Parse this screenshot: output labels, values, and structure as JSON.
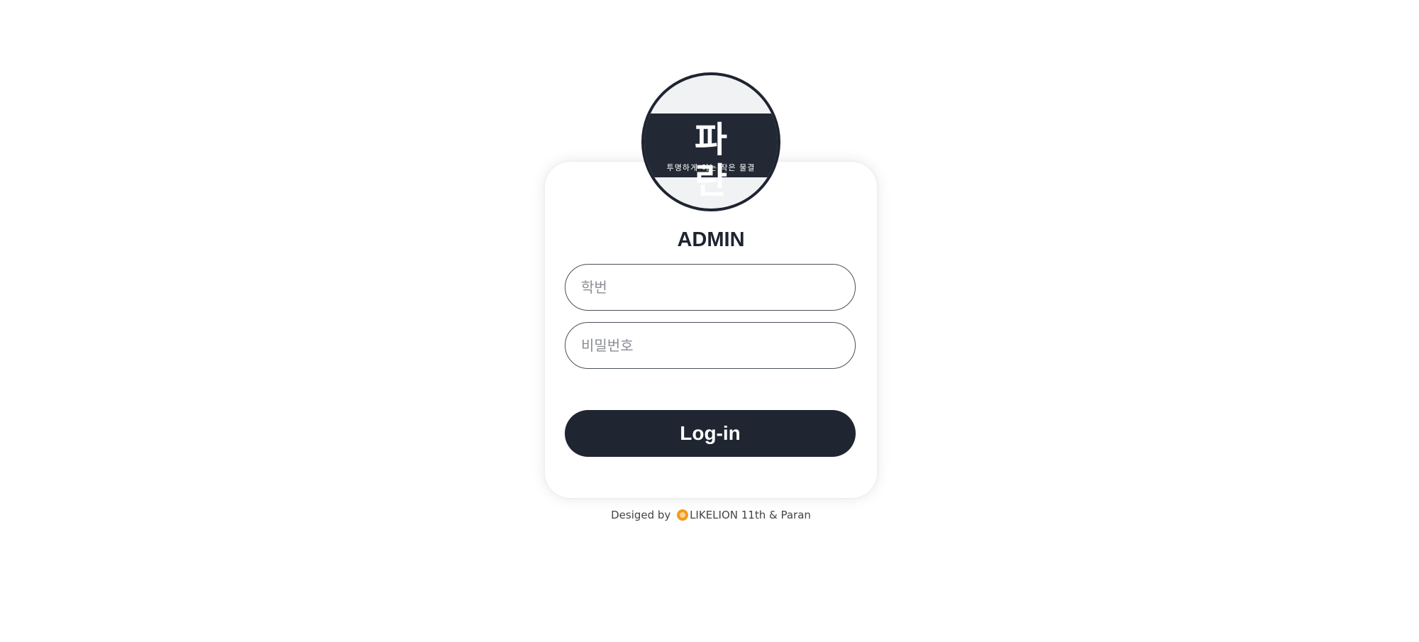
{
  "logo": {
    "title": "파 란",
    "subtitle": "투명하게 이는 작은 물결"
  },
  "login": {
    "heading": "ADMIN",
    "student_id_placeholder": "학번",
    "password_placeholder": "비밀번호",
    "submit_label": "Log-in"
  },
  "footer": {
    "prefix": "Desiged by",
    "icon": "lion-icon",
    "credit": "LIKELION 11th & Paran"
  },
  "colors": {
    "primary": "#1f2531",
    "background": "#ffffff",
    "logo_background": "#f1f2f4"
  }
}
